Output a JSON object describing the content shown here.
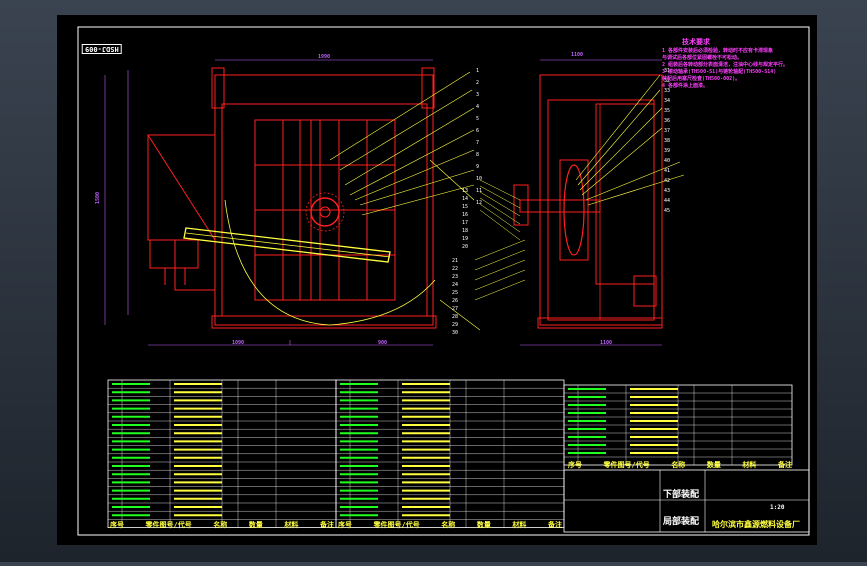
{
  "drawing": {
    "stamp": "HSDJ-009",
    "notes_title": "技术要求",
    "notes": [
      "1  各部件安装后必须检验，转动时不应有卡滞现象",
      "   与调试后各部位紧固螺栓不可松动。",
      "2  组装后各转动部分表面清洁，注油中心线与规定平行。",
      "3  滚动轴承(TH500-S1)与链轮轴配(TH500-S14)",
      "   装配后用塞尺检查(TH500-002)。",
      "4  各部件涂上面漆。"
    ],
    "title_block": {
      "drawing_name": "下部装配",
      "company": "哈尔滨市鑫源燃料设备厂",
      "scale": "1:20",
      "stamp_label": "局部装配"
    },
    "table_header": [
      "序号",
      "零件图号/代号",
      "名称",
      "数量",
      "材料",
      "备注"
    ],
    "dims": {
      "width": "1990",
      "left": "1090",
      "right": "900",
      "height": "1500",
      "side_left": "1100",
      "side": "1100"
    },
    "part_numbers": [
      "1",
      "2",
      "3",
      "4",
      "5",
      "6",
      "7",
      "8",
      "9",
      "10",
      "11",
      "12",
      "13",
      "14",
      "15",
      "16",
      "17",
      "18",
      "19",
      "20",
      "21",
      "22",
      "23",
      "24",
      "25",
      "26",
      "27",
      "28",
      "29",
      "30",
      "31",
      "32",
      "33",
      "34",
      "35",
      "36",
      "37",
      "38",
      "39",
      "40",
      "41",
      "42",
      "43",
      "44",
      "45"
    ]
  },
  "colors": {
    "frame": "#ffffff",
    "part": "#ff2020",
    "leader": "#ffff40",
    "dim": "#c060ff",
    "text": "#ffffff",
    "note": "#ff40ff",
    "hatch": "#20ff20"
  }
}
